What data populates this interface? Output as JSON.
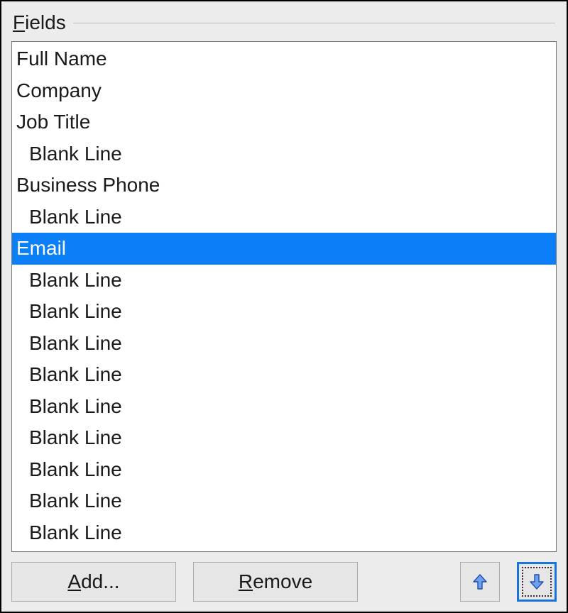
{
  "groupLabel": {
    "mnemonic": "F",
    "rest": "ields"
  },
  "fields": [
    {
      "label": "Full Name",
      "indented": false,
      "selected": false
    },
    {
      "label": "Company",
      "indented": false,
      "selected": false
    },
    {
      "label": "Job Title",
      "indented": false,
      "selected": false
    },
    {
      "label": "Blank Line",
      "indented": true,
      "selected": false
    },
    {
      "label": "Business Phone",
      "indented": false,
      "selected": false
    },
    {
      "label": "Blank Line",
      "indented": true,
      "selected": false
    },
    {
      "label": "Email",
      "indented": false,
      "selected": true
    },
    {
      "label": "Blank Line",
      "indented": true,
      "selected": false
    },
    {
      "label": "Blank Line",
      "indented": true,
      "selected": false
    },
    {
      "label": "Blank Line",
      "indented": true,
      "selected": false
    },
    {
      "label": "Blank Line",
      "indented": true,
      "selected": false
    },
    {
      "label": "Blank Line",
      "indented": true,
      "selected": false
    },
    {
      "label": "Blank Line",
      "indented": true,
      "selected": false
    },
    {
      "label": "Blank Line",
      "indented": true,
      "selected": false
    },
    {
      "label": "Blank Line",
      "indented": true,
      "selected": false
    },
    {
      "label": "Blank Line",
      "indented": true,
      "selected": false
    }
  ],
  "buttons": {
    "add": {
      "mnemonic": "A",
      "rest": "dd..."
    },
    "remove": {
      "mnemonic": "R",
      "rest": "emove"
    }
  },
  "colors": {
    "selectionBg": "#0a7ff7",
    "iconBlue": "#3a72d8"
  }
}
